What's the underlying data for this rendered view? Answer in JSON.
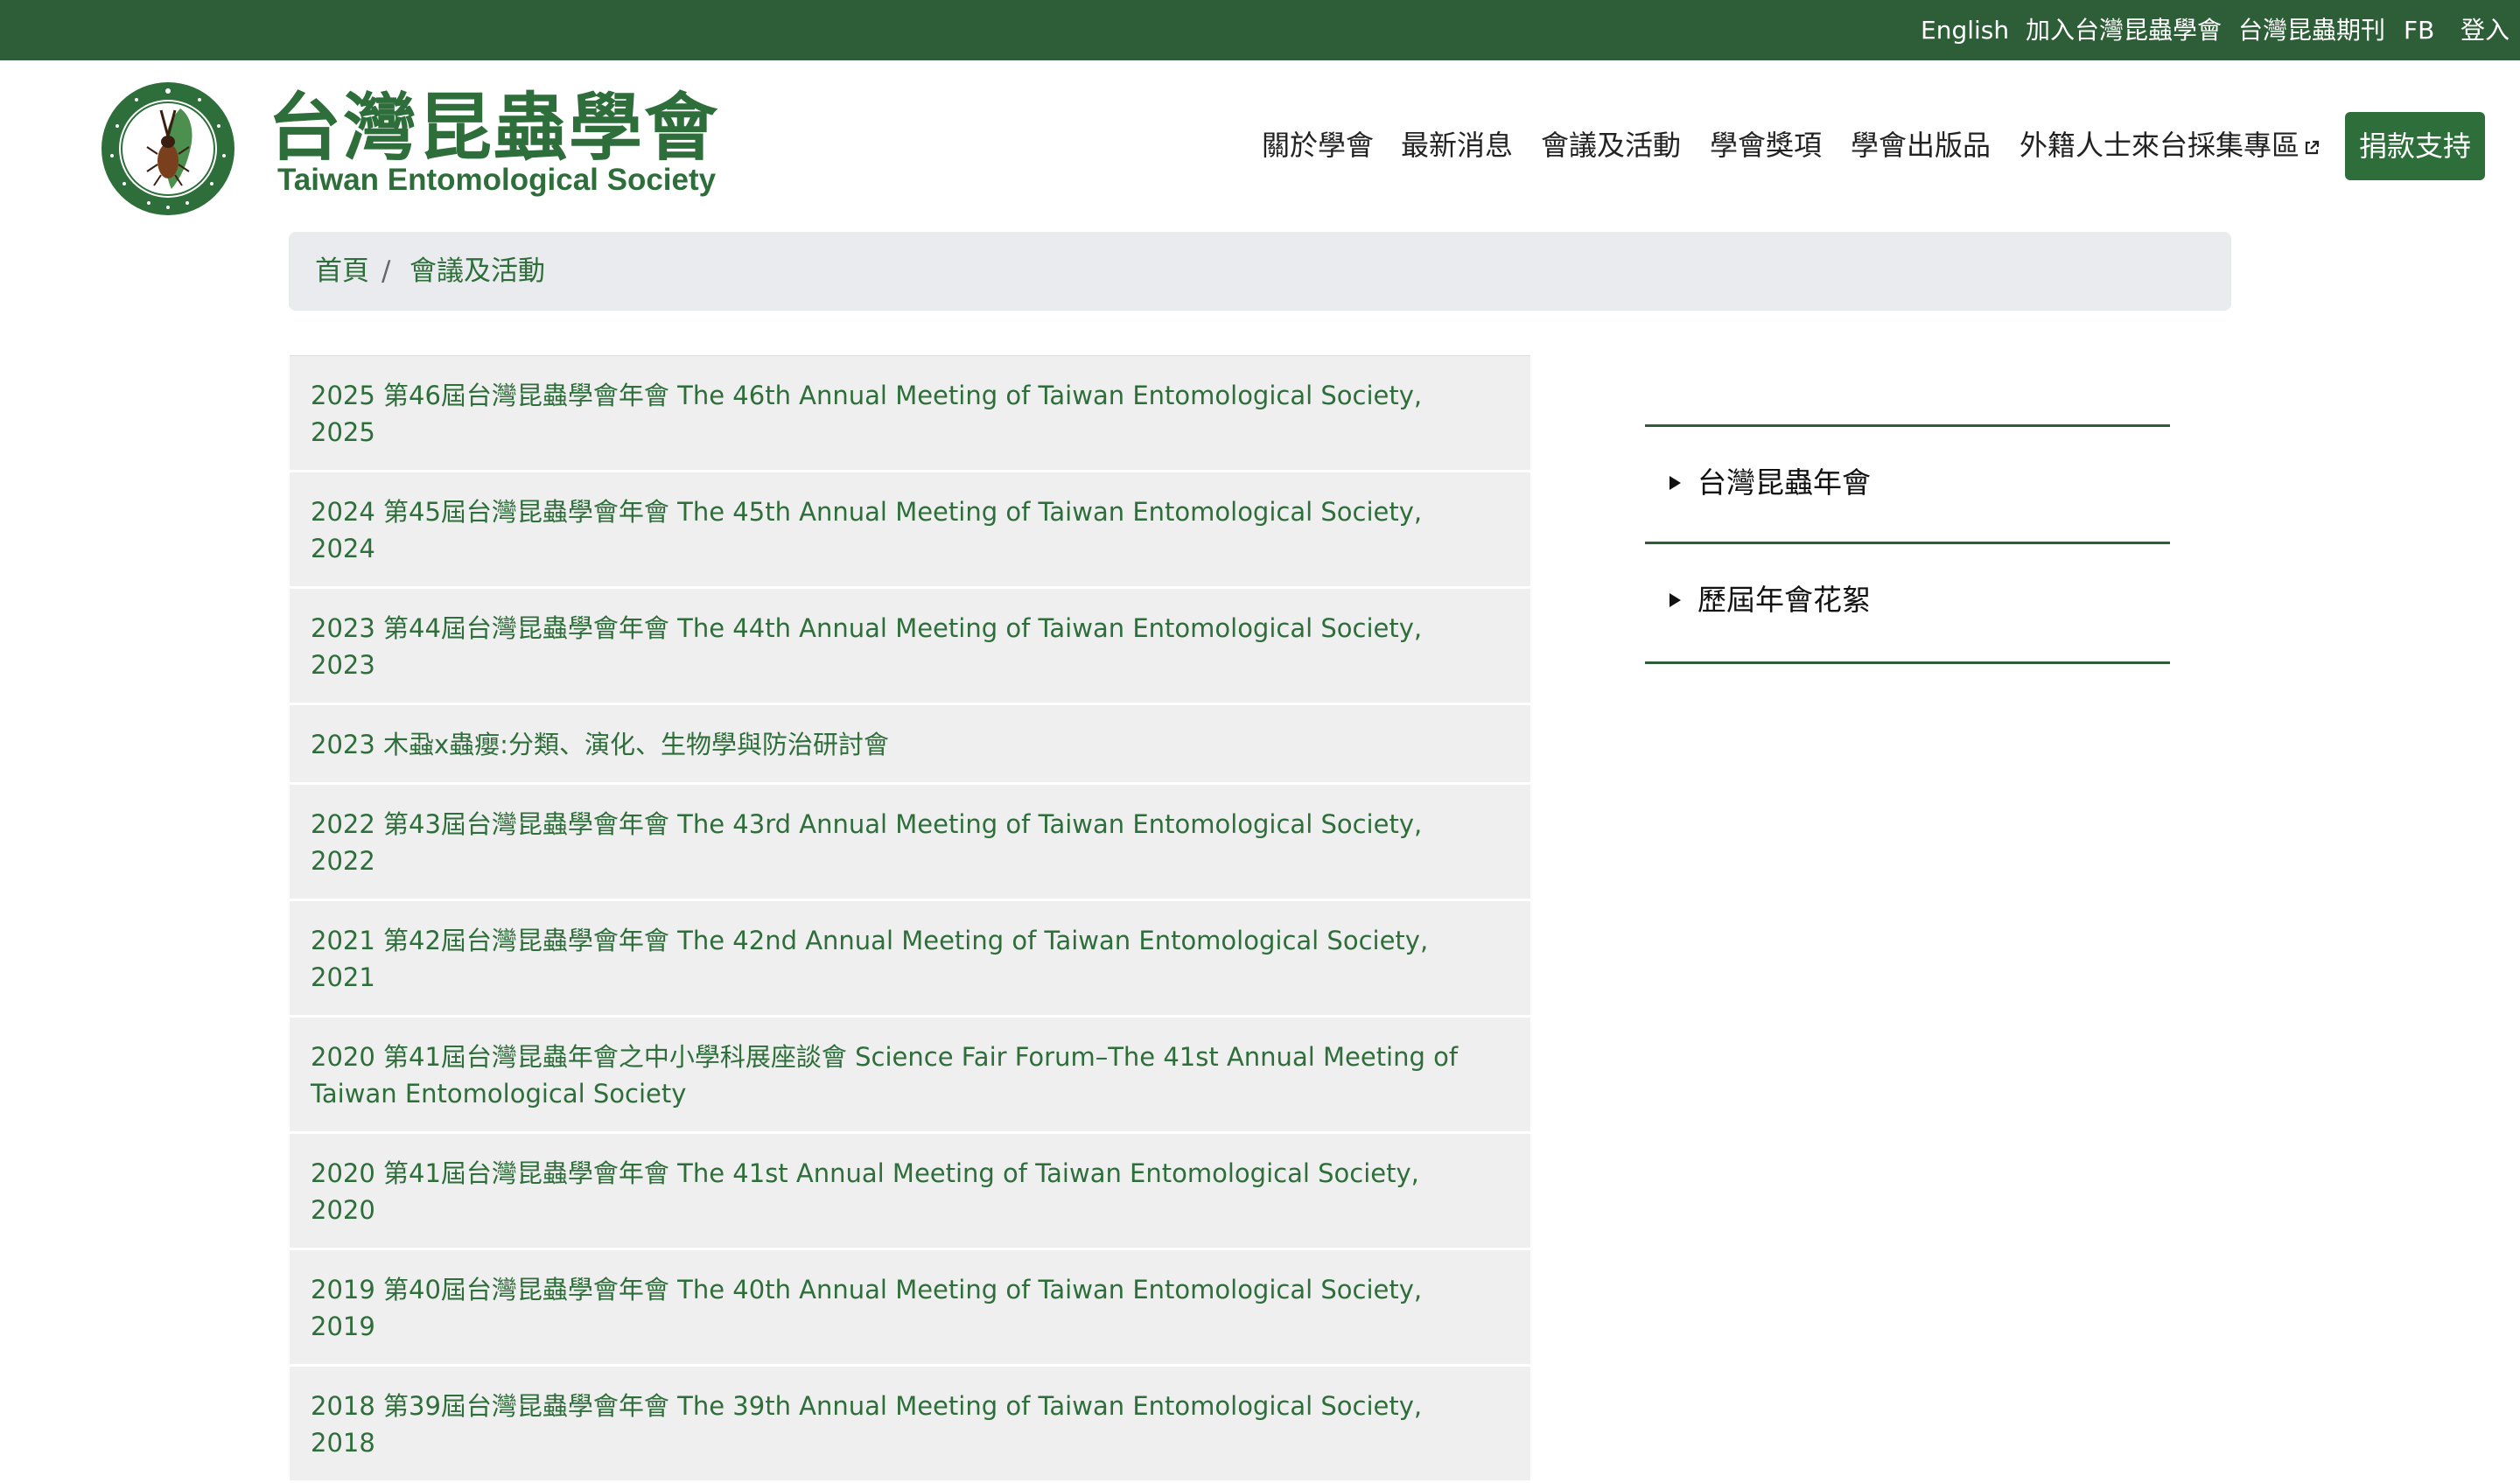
{
  "topbar": {
    "english": "English",
    "join": "加入台灣昆蟲學會",
    "journal": "台灣昆蟲期刊",
    "fb": "FB",
    "login": "登入"
  },
  "logo": {
    "title": "台灣昆蟲學會",
    "subtitle": "Taiwan Entomological Society",
    "emblem_text": "台灣昆蟲學會"
  },
  "nav": {
    "about": "關於學會",
    "news": "最新消息",
    "events": "會議及活動",
    "awards": "學會獎項",
    "publications": "學會出版品",
    "foreign": "外籍人士來台採集專區",
    "donate": "捐款支持"
  },
  "breadcrumb": {
    "home": "首頁",
    "separator": "/",
    "current": "會議及活動"
  },
  "events": [
    "2025 第46屆台灣昆蟲學會年會 The 46th Annual Meeting of Taiwan Entomological Society, 2025",
    "2024 第45屆台灣昆蟲學會年會 The 45th Annual Meeting of Taiwan Entomological Society, 2024",
    "2023 第44屆台灣昆蟲學會年會 The 44th Annual Meeting of Taiwan Entomological Society, 2023",
    "2023 木蝨x蟲癭:分類、演化、生物學與防治研討會",
    "2022 第43屆台灣昆蟲學會年會 The 43rd Annual Meeting of Taiwan Entomological Society, 2022",
    "2021 第42屆台灣昆蟲學會年會 The 42nd Annual Meeting of Taiwan Entomological Society, 2021",
    "2020 第41屆台灣昆蟲年會之中小學科展座談會 Science Fair Forum–The 41st Annual Meeting of Taiwan Entomological Society",
    "2020 第41屆台灣昆蟲學會年會 The 41st Annual Meeting of Taiwan Entomological Society, 2020",
    "2019 第40屆台灣昆蟲學會年會 The 40th Annual Meeting of Taiwan Entomological Society, 2019",
    "2018 第39屆台灣昆蟲學會年會 The 39th Annual Meeting of Taiwan Entomological Society, 2018"
  ],
  "sidebar": {
    "items": [
      "台灣昆蟲年會",
      "歷屆年會花絮"
    ]
  },
  "icons": {
    "emblem": "beetle-emblem-icon",
    "external": "external-link-icon",
    "caret": "caret-right-icon"
  },
  "colors": {
    "brand_green": "#2e6e3a",
    "topbar_green": "#2e5e37",
    "list_bg": "#efefef",
    "breadcrumb_bg": "#e9ebee"
  }
}
